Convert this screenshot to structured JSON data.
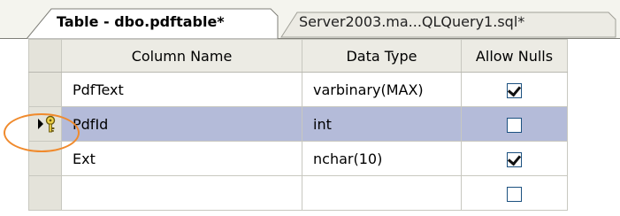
{
  "tabs": [
    {
      "label": "Table - dbo.pdftable*",
      "active": true
    },
    {
      "label": "Server2003.ma...QLQuery1.sql*",
      "active": false
    }
  ],
  "grid": {
    "headers": {
      "column_name": "Column Name",
      "data_type": "Data Type",
      "allow_nulls": "Allow Nulls"
    },
    "rows": [
      {
        "column_name": "PdfText",
        "data_type": "varbinary(MAX)",
        "allow_nulls": true,
        "selected": false,
        "primary_key": false
      },
      {
        "column_name": "PdfId",
        "data_type": "int",
        "allow_nulls": false,
        "selected": true,
        "primary_key": true
      },
      {
        "column_name": "Ext",
        "data_type": "nchar(10)",
        "allow_nulls": true,
        "selected": false,
        "primary_key": false
      },
      {
        "column_name": "",
        "data_type": "",
        "allow_nulls": false,
        "selected": false,
        "primary_key": false
      }
    ]
  },
  "icons": {
    "current_row": "arrow-right-icon",
    "primary_key": "key-icon"
  },
  "colors": {
    "selected_row": "#b4bbd9",
    "highlight_callout": "#f08a2c",
    "header_bg": "#ecebe4"
  }
}
